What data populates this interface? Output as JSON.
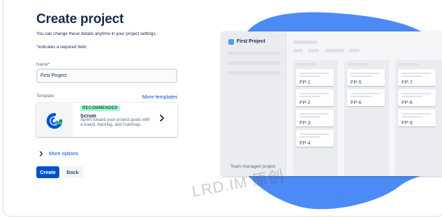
{
  "form": {
    "title": "Create project",
    "subtitle": "You can change these details anytime in your project settings.",
    "required_star": "*",
    "required_note": "indicates a required field.",
    "name_label": "Name",
    "name_value": "First Project",
    "template_label": "Template",
    "more_templates": "More templates",
    "template": {
      "badge": "RECOMMENDED",
      "name": "Scrum",
      "description": "Sprint toward your project goals with a board, backlog, and roadmap."
    },
    "more_options": "More options",
    "create_button": "Create",
    "back_button": "Back"
  },
  "illustration": {
    "project_name": "First Project",
    "footer_label": "Team-managed project",
    "columns": [
      {
        "cards": [
          "FP-1",
          "FP-2",
          "FP-3",
          "FP-4"
        ]
      },
      {
        "cards": [
          "FP-5",
          "FP-6"
        ]
      },
      {
        "cards": [
          "FP-7",
          "FP-8",
          "FP-9"
        ]
      }
    ]
  },
  "watermark": "LRD.IM 原创",
  "colors": {
    "accent": "#0052cc",
    "blob": "#4c8bf5",
    "required": "#de350b",
    "badge_bg": "#abf5d1",
    "badge_text": "#006644"
  },
  "icons": {
    "template_icon": "scrum-cycle-icon",
    "template_chevron": "chevron-right-icon",
    "more_options_chevron": "chevron-right-icon"
  }
}
